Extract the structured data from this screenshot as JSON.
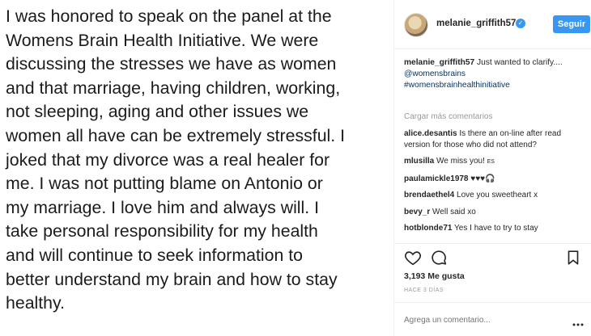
{
  "post": {
    "text": "I was honored to speak on the panel at the\nWomens Brain Health Initiative. We were\ndiscussing the stresses we have as women\nand that marriage, having children, working,\nnot sleeping, aging and other issues we\nwomen all have can be extremely stressful. I\njoked that my divorce was a real healer for\nme. I was not putting blame on Antonio or\nmy marriage. I love him and always will. I\ntake personal responsibility for my health\nand will continue to seek information to\nbetter understand my brain and how to stay\nhealthy."
  },
  "header": {
    "username": "melanie_griffith57",
    "verified_mark": "✓",
    "follow_label": "Seguir"
  },
  "caption": {
    "user": "melanie_griffith57",
    "text": " Just wanted to clarify....",
    "mention": "@womensbrains",
    "hashtag": "#womensbrainhealthinitiative"
  },
  "load_more": "Cargar más comentarios",
  "comments": [
    {
      "user": "alice.desantis",
      "text": " Is there an on-line after read version for those who did not attend?"
    },
    {
      "user": "mlusilla",
      "text": " We miss you! ",
      "extra": "ES"
    },
    {
      "user": "paulamickle1978",
      "text": " ♥♥♥🎧"
    },
    {
      "user": "brendaethel4",
      "text": " Love you sweetheart x"
    },
    {
      "user": "bevy_r",
      "text": " Well said xo"
    },
    {
      "user": "hotblonde71",
      "text": " Yes I have to try to stay"
    }
  ],
  "likes": "3,193 Me gusta",
  "timestamp": "HACE 3 DÍAS",
  "add_comment_placeholder": "Agrega un comentario...",
  "icons": {
    "like": "heart-icon",
    "comment": "comment-bubble-icon",
    "save": "bookmark-icon",
    "more": "more-options-icon"
  },
  "colors": {
    "accent": "#3897f0",
    "link": "#003569",
    "muted": "#999999",
    "text": "#262626"
  }
}
